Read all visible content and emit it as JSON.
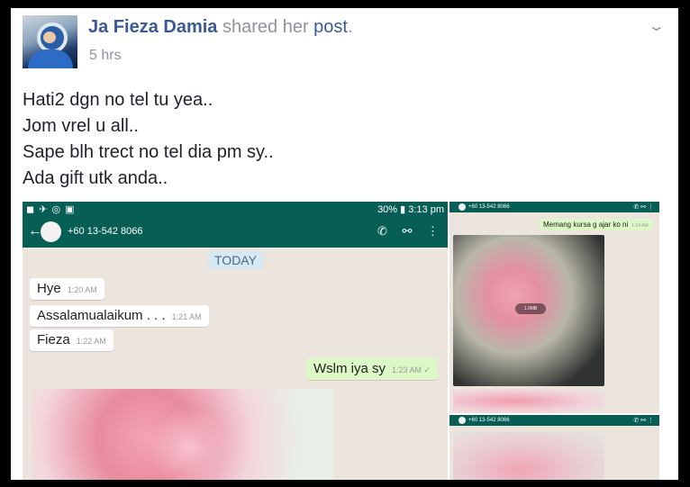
{
  "post": {
    "author": "Ja Fieza Damia",
    "action": "shared her",
    "link": "post",
    "period": ".",
    "timestamp": "5 hrs",
    "options_icon": "chevron-down-icon",
    "lines": [
      "Hati2 dgn no tel tu yea..",
      "Jom vrel u all..",
      "Sape blh trect no tel dia pm sy..",
      "Ada gift utk anda.."
    ]
  },
  "screenshot1": {
    "status_left": "◼ ✈ ◎ ▣",
    "status_right": "30% ▮ 3:13 pm",
    "contact": "+60 13-542 8066",
    "date_chip": "TODAY",
    "messages": [
      {
        "text": "Hye",
        "time": "1:20 AM"
      },
      {
        "text": "Assalamualaikum . . .",
        "time": "1:21 AM"
      },
      {
        "text": "Fieza",
        "time": "1:22 AM"
      },
      {
        "text": "Wslm iya sy",
        "time": "1:23 AM ✓"
      }
    ]
  },
  "screenshot2": {
    "contact": "+60 13-542 8066",
    "message": "Memang kursa g ajar ko ni",
    "time": "1:24 AM",
    "media_label": "1.0MB"
  },
  "screenshot3": {
    "contact": "+60 13-542 8066"
  },
  "colors": {
    "facebook_blue": "#3b5998",
    "whatsapp_green": "#075e54",
    "chat_bg": "#ece5dd",
    "outgoing_bubble": "#dcf8c6"
  }
}
